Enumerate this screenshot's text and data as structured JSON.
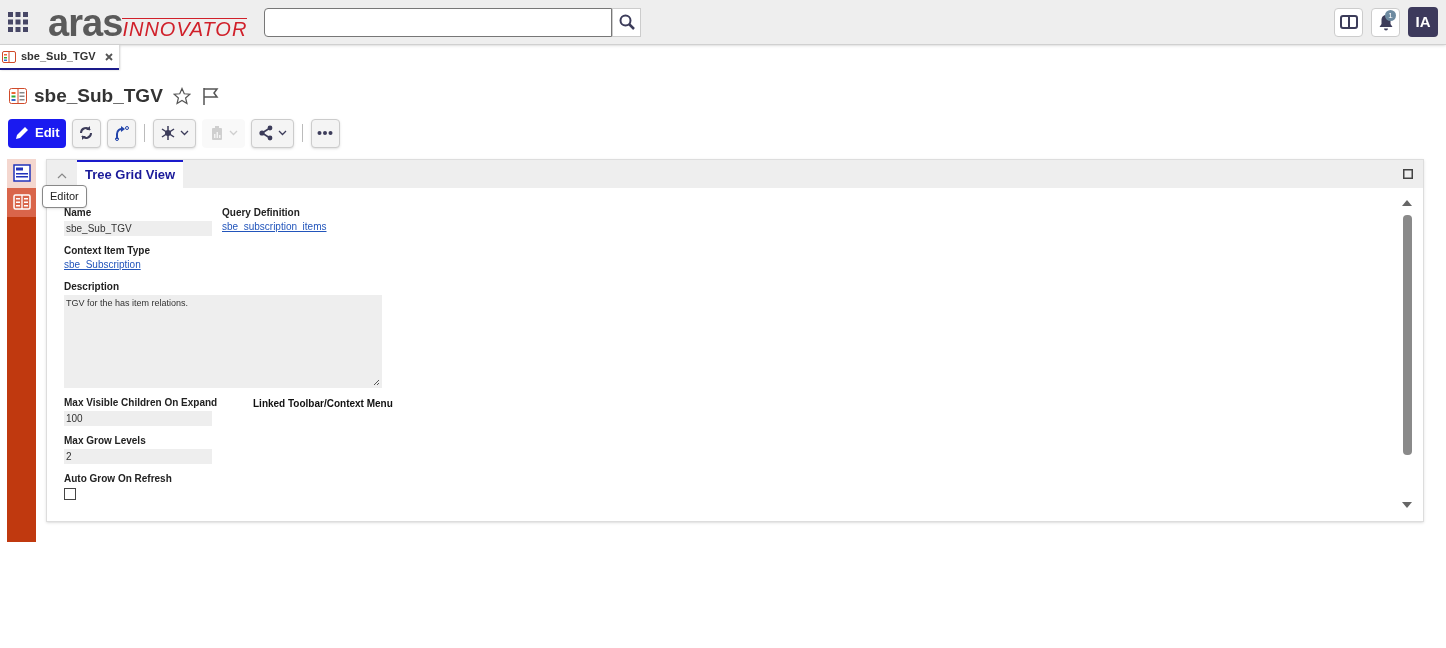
{
  "header": {
    "logo_main": "aras",
    "logo_sub": "INNOVATOR",
    "notifications_count": "1",
    "user_initials": "IA"
  },
  "tabs": [
    {
      "label": "sbe_Sub_TGV",
      "selected": true
    }
  ],
  "item": {
    "title": "sbe_Sub_TGV",
    "favorite": false
  },
  "toolbar": [
    {
      "kind": "primary",
      "label": "Edit",
      "disabled": false
    },
    {
      "kind": "icon",
      "disabled": false
    },
    {
      "kind": "icon",
      "disabled": false
    },
    {
      "kind": "separator"
    },
    {
      "kind": "dropdown",
      "disabled": false
    },
    {
      "kind": "dropdown",
      "disabled": true
    },
    {
      "kind": "dropdown",
      "disabled": false
    },
    {
      "kind": "separator"
    },
    {
      "kind": "icon",
      "disabled": false
    }
  ],
  "sidebar": [
    {
      "selected": false
    },
    {
      "selected": true
    }
  ],
  "tooltip": "Editor",
  "panel": {
    "tab": "Tree Grid View",
    "expanded": true
  },
  "form": {
    "left": [
      {
        "kind": "field",
        "label": "Name",
        "value": "sbe_Sub_TGV"
      },
      {
        "kind": "link",
        "label": "Context Item Type",
        "value": "sbe_Subscription"
      },
      {
        "kind": "textarea",
        "label": "Description",
        "value": "TGV for the has item relations."
      },
      {
        "kind": "field",
        "label": "Max Visible Children On Expand",
        "value": "100"
      },
      {
        "kind": "field",
        "label": "Max Grow Levels",
        "value": "2"
      },
      {
        "kind": "checkbox",
        "label": "Auto Grow On Refresh",
        "checked": false
      }
    ],
    "right": [
      {
        "kind": "link",
        "label": "Query Definition",
        "value": "sbe_subscription_items"
      },
      {
        "kind": "heading",
        "label": "Linked Toolbar/Context Menu"
      }
    ]
  }
}
